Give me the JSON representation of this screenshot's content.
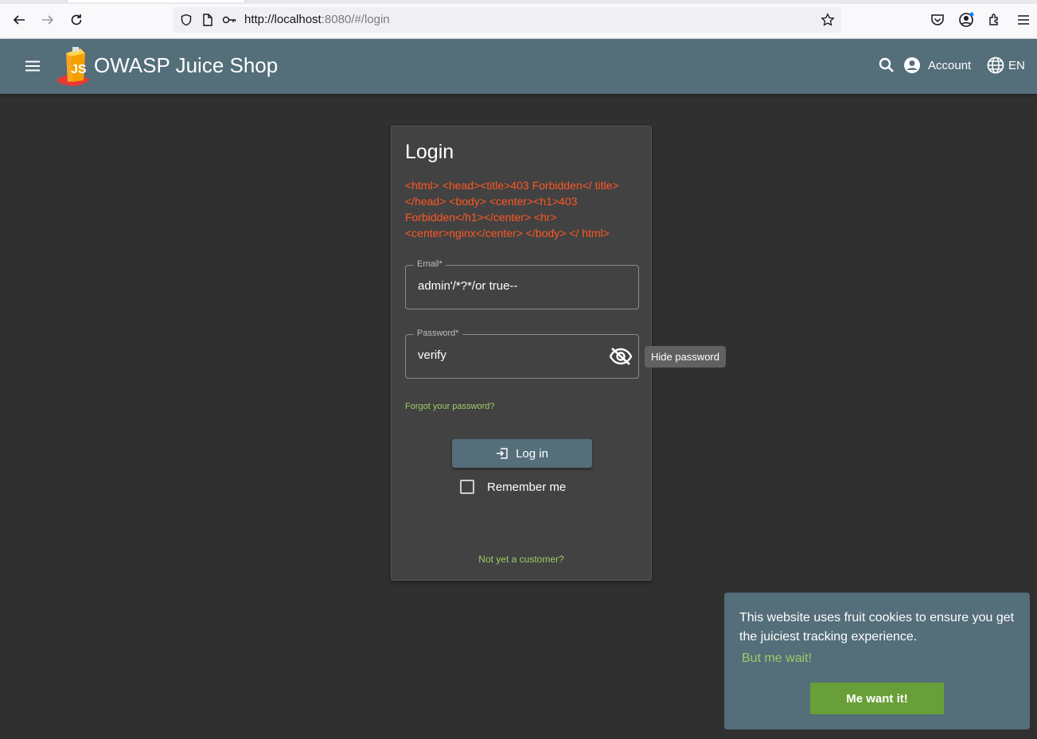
{
  "browser": {
    "url_host": "http://localhost",
    "url_rest": ":8080/#/login",
    "icons": [
      "back-arrow-icon",
      "forward-arrow-icon",
      "reload-icon",
      "shield-icon",
      "page-icon",
      "key-icon",
      "star-icon",
      "pocket-icon",
      "profile-icon",
      "extensions-icon",
      "hamburger-menu-icon"
    ]
  },
  "header": {
    "app_title": "OWASP Juice Shop",
    "account_label": "Account",
    "language_label": "EN"
  },
  "login": {
    "title": "Login",
    "error_message": "<html> <head><title>403 Forbidden</ title></head> <body> <center><h1>403 Forbidden</h1></center> <hr><center>nginx</center> </body> </ html>",
    "email_label": "Email*",
    "email_value": "admin'/*?*/or true--",
    "password_label": "Password*",
    "password_value": "verify",
    "hide_password_tooltip": "Hide password",
    "forgot_password": "Forgot your password?",
    "login_button": "Log in",
    "remember_me": "Remember me",
    "signup_link": "Not yet a customer?"
  },
  "cookie_banner": {
    "message": "This website uses fruit cookies to ensure you get the juiciest tracking experience.",
    "more_link": "But me wait!",
    "accept_button": "Me want it!"
  },
  "colors": {
    "toolbar": "#546e7a",
    "background": "#303030",
    "card": "#424242",
    "error": "#ff5722",
    "link": "#9ccc65",
    "accept": "#689f38"
  }
}
